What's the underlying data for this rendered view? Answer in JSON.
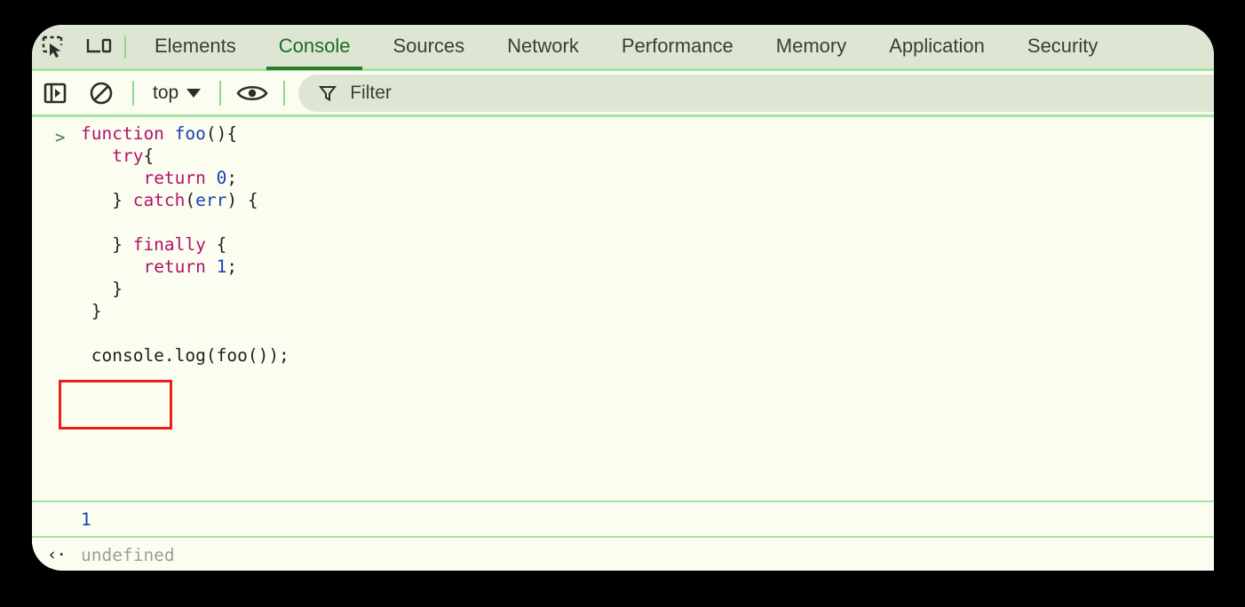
{
  "window": {
    "background_color": "#000000",
    "panel_background": "#fbfdf0",
    "tabbar_background": "#dde6d3",
    "accent_green": "#a5e3a0",
    "active_tab_color": "#2f7a2f",
    "annotation_color": "#ee1c1c"
  },
  "tabbar": {
    "icons": [
      {
        "name": "inspect-element-icon",
        "label": "Inspect element"
      },
      {
        "name": "device-toolbar-icon",
        "label": "Toggle device toolbar"
      }
    ],
    "tabs": [
      {
        "label": "Elements",
        "active": false
      },
      {
        "label": "Console",
        "active": true
      },
      {
        "label": "Sources",
        "active": false
      },
      {
        "label": "Network",
        "active": false
      },
      {
        "label": "Performance",
        "active": false
      },
      {
        "label": "Memory",
        "active": false
      },
      {
        "label": "Application",
        "active": false
      },
      {
        "label": "Security",
        "active": false
      }
    ]
  },
  "console_toolbar": {
    "sidebar_toggle": {
      "name": "console-sidebar-toggle-icon",
      "label": "Show console sidebar"
    },
    "clear_console": {
      "name": "clear-console-icon",
      "label": "Clear console"
    },
    "context_selector": {
      "value": "top"
    },
    "eye_icon": {
      "name": "live-expression-icon",
      "label": "Create live expression"
    },
    "filter": {
      "placeholder": "Filter",
      "value": ""
    }
  },
  "console": {
    "input_lines": [
      [
        {
          "text": "function ",
          "cls": "kw"
        },
        {
          "text": "foo",
          "cls": "fn"
        },
        {
          "text": "(){",
          "cls": "plain"
        }
      ],
      [
        {
          "text": "   ",
          "cls": "plain"
        },
        {
          "text": "try",
          "cls": "kw"
        },
        {
          "text": "{",
          "cls": "plain"
        }
      ],
      [
        {
          "text": "      ",
          "cls": "plain"
        },
        {
          "text": "return ",
          "cls": "kw"
        },
        {
          "text": "0",
          "cls": "num"
        },
        {
          "text": ";",
          "cls": "plain"
        }
      ],
      [
        {
          "text": "   } ",
          "cls": "plain"
        },
        {
          "text": "catch",
          "cls": "kw"
        },
        {
          "text": "(",
          "cls": "plain"
        },
        {
          "text": "err",
          "cls": "param"
        },
        {
          "text": ") {",
          "cls": "plain"
        }
      ],
      [
        {
          "text": "",
          "cls": "plain"
        }
      ],
      [
        {
          "text": "   } ",
          "cls": "plain"
        },
        {
          "text": "finally",
          "cls": "kw"
        },
        {
          "text": " {",
          "cls": "plain"
        }
      ],
      [
        {
          "text": "      ",
          "cls": "plain"
        },
        {
          "text": "return ",
          "cls": "kw"
        },
        {
          "text": "1",
          "cls": "num"
        },
        {
          "text": ";",
          "cls": "plain"
        }
      ],
      [
        {
          "text": "   }",
          "cls": "plain"
        }
      ],
      [
        {
          "text": " }",
          "cls": "plain"
        }
      ],
      [
        {
          "text": "",
          "cls": "plain"
        }
      ],
      [
        {
          "text": " console.log(foo());",
          "cls": "plain"
        }
      ]
    ],
    "prompt_symbol": ">",
    "log_output": "1",
    "return_arrow": "‹·",
    "return_value": "undefined",
    "new_prompt_symbol": ">",
    "new_prompt_value": ""
  },
  "annotation": {
    "target": "log-output-value",
    "note": "red rectangle highlighting the console log result"
  }
}
